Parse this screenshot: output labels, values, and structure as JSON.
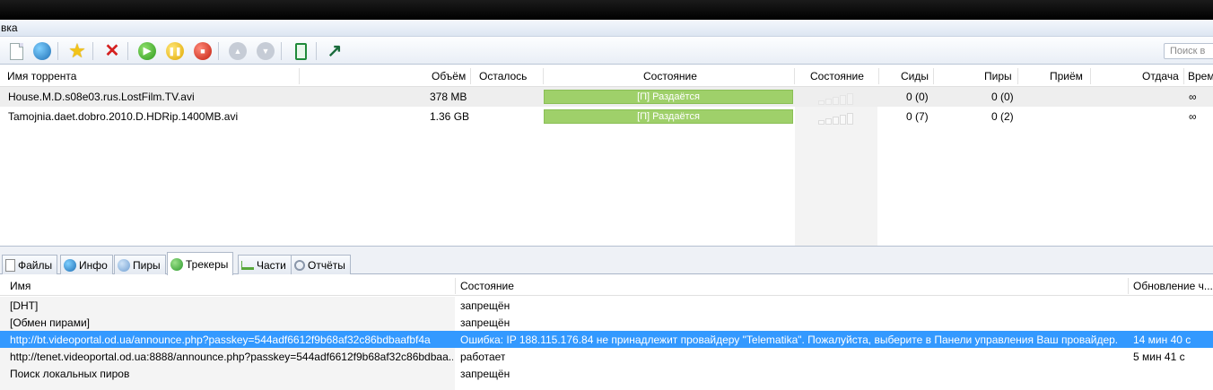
{
  "menu": {
    "partial_label": "вка"
  },
  "toolbar": {
    "buttons": [
      {
        "name": "add-torrent-icon",
        "glyph": ""
      },
      {
        "name": "add-url-icon",
        "glyph": ""
      },
      {
        "name": "favorites-star-icon",
        "glyph": "★"
      },
      {
        "name": "remove-icon",
        "glyph": "✕"
      },
      {
        "name": "start-icon",
        "glyph": "▶"
      },
      {
        "name": "pause-icon",
        "glyph": "❚❚"
      },
      {
        "name": "stop-icon",
        "glyph": "■"
      },
      {
        "name": "move-up-icon",
        "glyph": "▲"
      },
      {
        "name": "move-down-icon",
        "glyph": "▼"
      },
      {
        "name": "remote-device-icon",
        "glyph": ""
      },
      {
        "name": "share-icon",
        "glyph": "↗"
      }
    ],
    "search_placeholder": "Поиск в"
  },
  "torrents": {
    "columns": [
      "Имя торрента",
      "Объём",
      "Осталось",
      "Состояние",
      "Состояние",
      "Сиды",
      "Пиры",
      "Приём",
      "Отдача",
      "Врем"
    ],
    "rows": [
      {
        "name": "House.M.D.s08e03.rus.LostFilm.TV.avi",
        "size": "378 MB",
        "remaining": "",
        "status": "[П] Раздаётся",
        "progress": 1.0,
        "seeds": "0 (0)",
        "peers": "0 (0)",
        "down": "",
        "up": "",
        "eta": "∞"
      },
      {
        "name": "Tamojnia.daet.dobro.2010.D.HDRip.1400MB.avi",
        "size": "1.36 GB",
        "remaining": "",
        "status": "[П] Раздаётся",
        "progress": 1.0,
        "seeds": "0 (7)",
        "peers": "0 (2)",
        "down": "",
        "up": "",
        "eta": "∞"
      }
    ]
  },
  "tabs": [
    {
      "label": "Файлы",
      "icon": "file-icon",
      "color": "#e8e8e8"
    },
    {
      "label": "Инфо",
      "icon": "globe-icon",
      "color": "#2f86c9"
    },
    {
      "label": "Пиры",
      "icon": "peers-icon",
      "color": "#7aa6d8"
    },
    {
      "label": "Трекеры",
      "icon": "tracker-icon",
      "color": "#3aa53a",
      "active": true
    },
    {
      "label": "Части",
      "icon": "pieces-icon",
      "color": "#6bb34a"
    },
    {
      "label": "Отчёты",
      "icon": "log-icon",
      "color": "#9aa7b8"
    }
  ],
  "trackers": {
    "columns": [
      "Имя",
      "Состояние",
      "Обновление ч..."
    ],
    "rows": [
      {
        "name": "[DHT]",
        "status": "запрещён",
        "update": ""
      },
      {
        "name": "[Обмен пирами]",
        "status": "запрещён",
        "update": ""
      },
      {
        "name": "http://bt.videoportal.od.ua/announce.php?passkey=544adf6612f9b68af32c86bdbaafbf4a",
        "status": "Ошибка: IP 188.115.176.84 не принадлежит провайдеру \"Telematika\". Пожалуйста, выберите в Панели управления Ваш провайдер.",
        "update": "14 мин 40 с",
        "selected": true
      },
      {
        "name": "http://tenet.videoportal.od.ua:8888/announce.php?passkey=544adf6612f9b68af32c86bdbaa...",
        "status": "работает",
        "update": "5 мин 41 с"
      },
      {
        "name": "Поиск локальных пиров",
        "status": "запрещён",
        "update": ""
      }
    ]
  },
  "colors": {
    "accent_selection": "#3399ff",
    "progress_seeding": "#9fd06a"
  }
}
